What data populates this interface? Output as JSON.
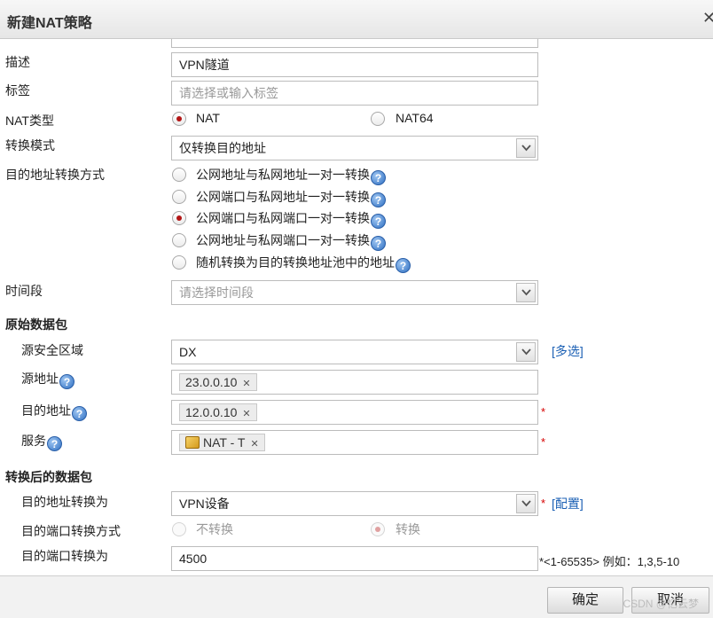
{
  "dialog": {
    "title": "新建NAT策略"
  },
  "fields": {
    "description": {
      "label": "描述",
      "value": "VPN隧道"
    },
    "tags": {
      "label": "标签",
      "placeholder": "请选择或输入标签"
    },
    "nat_type": {
      "label": "NAT类型",
      "options": [
        "NAT",
        "NAT64"
      ],
      "selected": "NAT"
    },
    "conversion_mode": {
      "label": "转换模式",
      "value": "仅转换目的地址"
    },
    "dest_conversion_method": {
      "label": "目的地址转换方式",
      "options": [
        "公网地址与私网地址一对一转换",
        "公网端口与私网地址一对一转换",
        "公网端口与私网端口一对一转换",
        "公网地址与私网端口一对一转换",
        "随机转换为目的转换地址池中的地址"
      ],
      "selected_index": 2,
      "help_icon": "help-icon"
    },
    "time_range": {
      "label": "时间段",
      "placeholder": "请选择时间段"
    }
  },
  "original_packet": {
    "section_title": "原始数据包",
    "source_zone": {
      "label": "源安全区域",
      "value": "DX",
      "link": "[多选]"
    },
    "source_address": {
      "label": "源地址",
      "tag": "23.0.0.10"
    },
    "dest_address": {
      "label": "目的地址",
      "tag": "12.0.0.10",
      "required": "*"
    },
    "service": {
      "label": "服务",
      "tag": "NAT - T",
      "required": "*"
    }
  },
  "translated_packet": {
    "section_title": "转换后的数据包",
    "dest_translate_to": {
      "label": "目的地址转换为",
      "value": "VPN设备",
      "required": "*",
      "link": "[配置]"
    },
    "dest_port_method": {
      "label": "目的端口转换方式",
      "options": [
        "不转换",
        "转换"
      ],
      "selected": "转换"
    },
    "dest_port_to": {
      "label": "目的端口转换为",
      "value": "4500",
      "hint": "*<1-65535> 例如：1,3,5-10"
    }
  },
  "footer": {
    "ok_label": "确定",
    "cancel_label": "取消",
    "watermark": "CSDN @忆云梦"
  },
  "colors": {
    "accent_radio": "#b31515",
    "link": "#1a5fb4",
    "required": "#d60000"
  }
}
